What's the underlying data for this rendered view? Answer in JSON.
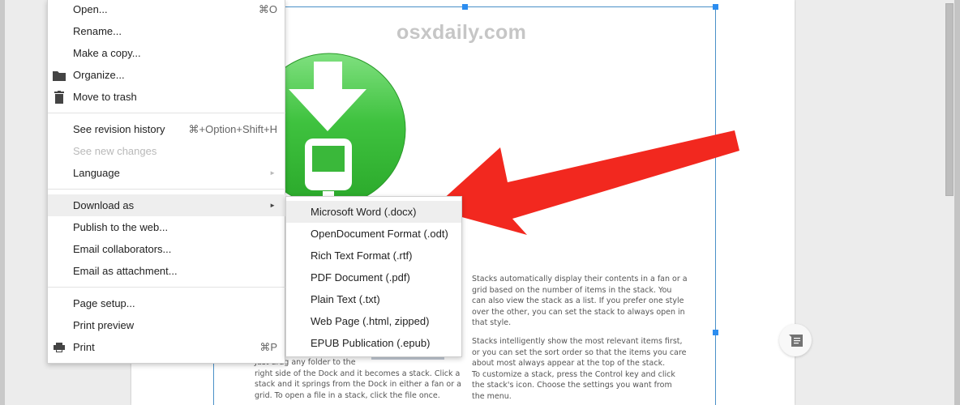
{
  "watermark": "osxdaily.com",
  "file_menu": {
    "items": [
      {
        "label": "Open...",
        "shortcut": "⌘O"
      },
      {
        "label": "Rename..."
      },
      {
        "label": "Make a copy..."
      },
      {
        "label": "Organize...",
        "icon": "folder-icon"
      },
      {
        "label": "Move to trash",
        "icon": "trash-icon"
      },
      {
        "label": "See revision history",
        "shortcut": "⌘+Option+Shift+H"
      },
      {
        "label": "See new changes",
        "disabled": true
      },
      {
        "label": "Language",
        "submenu": true,
        "arrow": "►"
      },
      {
        "label": "Download as",
        "submenu": true,
        "arrow": "►",
        "active": true
      },
      {
        "label": "Publish to the web..."
      },
      {
        "label": "Email collaborators..."
      },
      {
        "label": "Email as attachment..."
      },
      {
        "label": "Page setup..."
      },
      {
        "label": "Print preview"
      },
      {
        "label": "Print",
        "shortcut": "⌘P",
        "icon": "printer-icon"
      }
    ]
  },
  "download_submenu": {
    "items": [
      {
        "label": "Microsoft Word (.docx)",
        "active": true
      },
      {
        "label": "OpenDocument Format (.odt)"
      },
      {
        "label": "Rich Text Format (.rtf)"
      },
      {
        "label": "PDF Document (.pdf)"
      },
      {
        "label": "Plain Text (.txt)"
      },
      {
        "label": "Web Page (.html, zipped)"
      },
      {
        "label": "EPUB Publication (.epub)"
      }
    ]
  },
  "document": {
    "right_col_p1": [
      "Stacks automatically display their contents in a fan or a",
      "grid based on the number of items in the stack. You",
      "can also view the stack as a list. If you prefer one style",
      "over the other, you can set the stack to always open in",
      "that style."
    ],
    "right_col_p2": [
      "Stacks intelligently show the most relevant items first,",
      "or you can set the sort order so that the items you care",
      "about most always appear at the top of the stack.",
      "To customize a stack, press the Control key and click",
      "the stack's icon. Choose the settings you want from",
      "the menu."
    ],
    "left_col": [
      "Just drag any folder to the",
      "right side of the Dock and it becomes a stack. Click a",
      "stack and it springs from the Dock in either a fan or a",
      "grid. To open a file in a stack, click the file once."
    ]
  },
  "colors": {
    "annotation_arrow": "#f2281f",
    "icon_green": "#3cc03c",
    "selection_handle": "#2c8df0"
  }
}
